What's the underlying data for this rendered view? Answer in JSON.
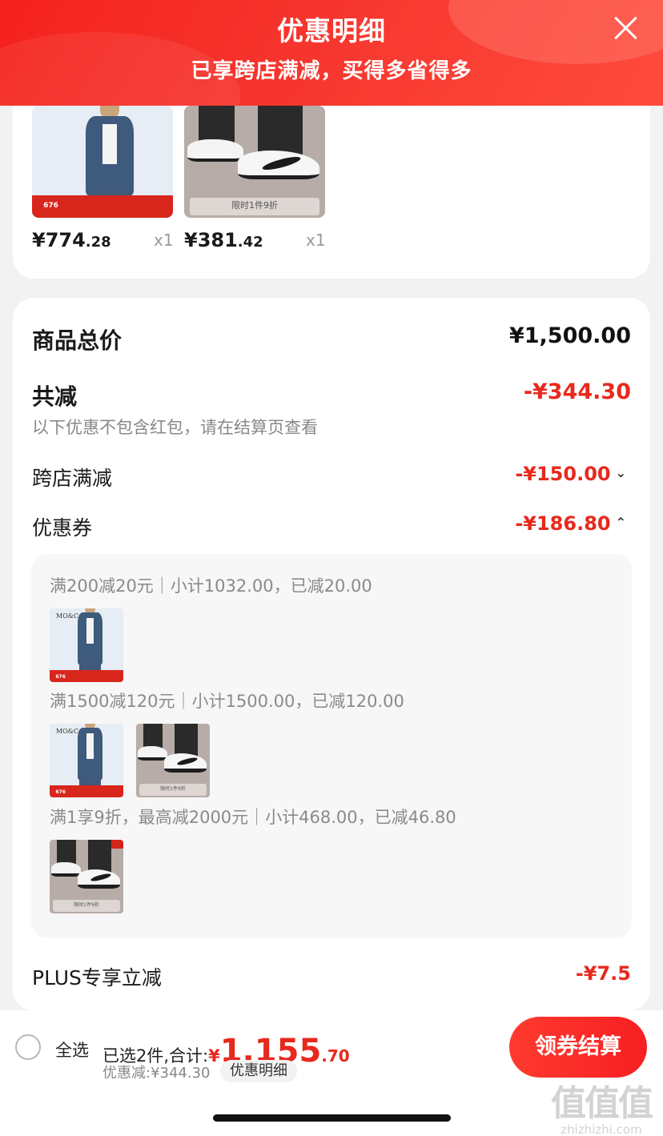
{
  "header": {
    "title": "优惠明细",
    "subtitle": "已享跨店满减，买得多省得多"
  },
  "products": [
    {
      "price_main": "¥774",
      "price_dec": ".28",
      "qty": "x1",
      "img_number": "676"
    },
    {
      "price_main": "¥381",
      "price_dec": ".42",
      "qty": "x1",
      "img_tag": "限时1件9折"
    }
  ],
  "summary": {
    "total_label": "商品总价",
    "total_value": "¥1,500.00",
    "reduce_label": "共减",
    "reduce_value": "-¥344.30",
    "reduce_note": "以下优惠不包含红包，请在结算页查看",
    "cross_store_label": "跨店满减",
    "cross_store_value": "-¥150.00",
    "coupon_label": "优惠券",
    "coupon_value": "-¥186.80",
    "plus_label": "PLUS专享立减",
    "plus_value": "-¥7.5"
  },
  "coupons": [
    {
      "text": "满200减20元｜小计1032.00，已减20.00"
    },
    {
      "text": "满1500减120元｜小计1500.00，已减120.00"
    },
    {
      "text": "满1享9折，最高减2000元｜小计468.00，已减46.80"
    }
  ],
  "thumb_texts": {
    "jacket_brand": "MO&Co.",
    "jacket_number": "676",
    "shoe_tag": "限时1件9折"
  },
  "bottom": {
    "select_all": "全选",
    "selected_text": "已选2件,合计:",
    "currency": "¥",
    "amount_main": "1,155",
    "amount_dec": ".70",
    "discount_text": "优惠减:¥344.30",
    "detail_chip": "优惠明细",
    "checkout": "领券结算"
  },
  "watermark": {
    "big": "值值值",
    "small": "zhizhizhi.com"
  }
}
